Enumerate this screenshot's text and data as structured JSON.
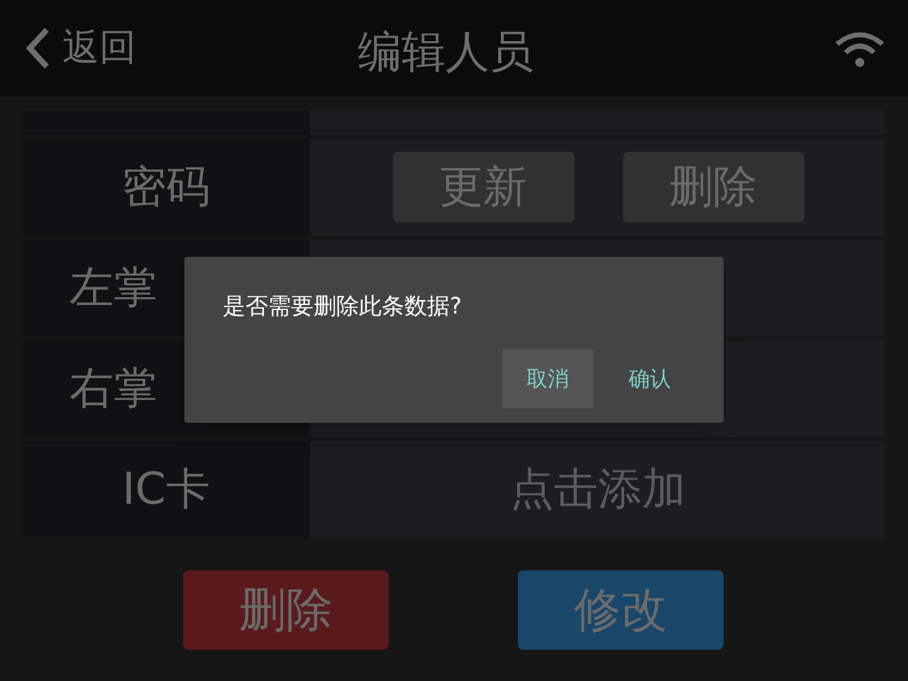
{
  "header": {
    "back_label": "返回",
    "title": "编辑人员"
  },
  "rows": [
    {
      "label": "密码",
      "kind": "buttons",
      "buttons": [
        "更新",
        "删除"
      ]
    },
    {
      "label": "左掌",
      "kind": "empty"
    },
    {
      "label": "右掌",
      "kind": "empty"
    },
    {
      "label": "IC卡",
      "kind": "action",
      "value": "点击添加"
    }
  ],
  "actions": [
    {
      "label": "删除",
      "kind": "danger"
    },
    {
      "label": "修改",
      "kind": "primary"
    }
  ],
  "dialog": {
    "message": "是否需要删除此条数据?",
    "buttons": [
      {
        "label": "取消",
        "selected": true
      },
      {
        "label": "确认",
        "selected": false
      }
    ]
  }
}
